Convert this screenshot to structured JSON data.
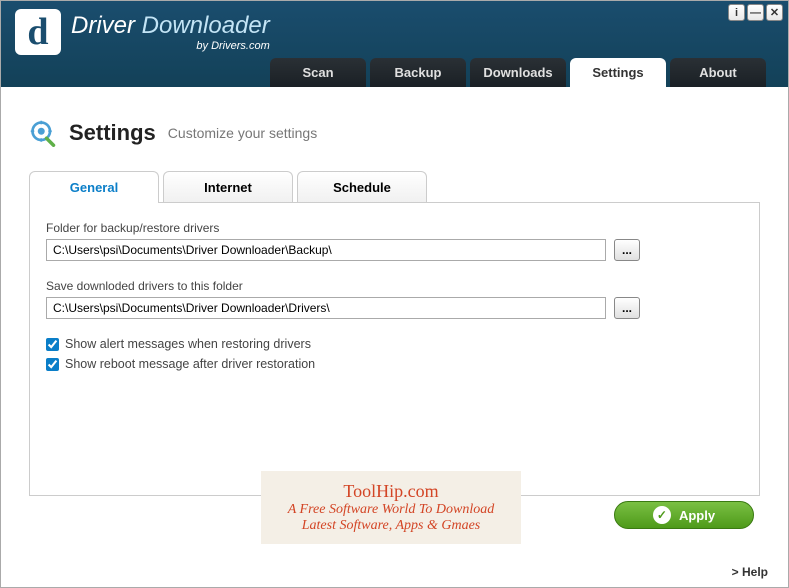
{
  "header": {
    "title_driver": "Driver",
    "title_downloader": "Downloader",
    "subtitle": "by Drivers.com"
  },
  "nav": {
    "scan": "Scan",
    "backup": "Backup",
    "downloads": "Downloads",
    "settings": "Settings",
    "about": "About"
  },
  "page": {
    "title": "Settings",
    "subtitle": "Customize your settings"
  },
  "tabs": {
    "general": "General",
    "internet": "Internet",
    "schedule": "Schedule"
  },
  "general": {
    "backup_label": "Folder for backup/restore drivers",
    "backup_path": "C:\\Users\\psi\\Documents\\Driver Downloader\\Backup\\",
    "download_label": "Save downloded drivers to this folder",
    "download_path": "C:\\Users\\psi\\Documents\\Driver Downloader\\Drivers\\",
    "browse_label": "...",
    "alert_checkbox": "Show alert messages when restoring drivers",
    "reboot_checkbox": "Show reboot message after driver restoration"
  },
  "buttons": {
    "apply": "Apply"
  },
  "footer": {
    "help": "> Help"
  },
  "watermark": {
    "title": "ToolHip.com",
    "line1": "A Free Software World To Download",
    "line2": "Latest Software, Apps & Gmaes"
  }
}
